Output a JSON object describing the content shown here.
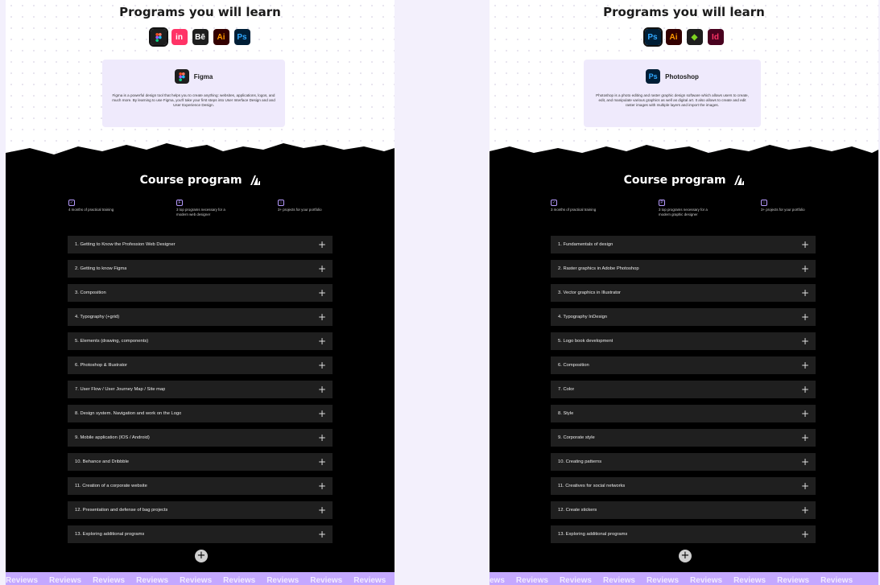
{
  "left": {
    "title": "Programs you will learn",
    "apps": [
      {
        "icon": "figma-icon",
        "text": "",
        "bg": "#1e1e1e",
        "fg": "#ffffff",
        "selected": true
      },
      {
        "icon": "invision-icon",
        "text": "in",
        "bg": "#ff3366",
        "fg": "#ffffff"
      },
      {
        "icon": "behance-icon",
        "text": "Bē",
        "bg": "#1e1e1e",
        "fg": "#ffffff"
      },
      {
        "icon": "illustrator-icon",
        "text": "Ai",
        "bg": "#330000",
        "fg": "#ff9a00"
      },
      {
        "icon": "photoshop-icon",
        "text": "Ps",
        "bg": "#001e36",
        "fg": "#31a8ff"
      }
    ],
    "card": {
      "name": "Figma",
      "description": "Figma is a powerful design tool that helps you to create anything: websites, applications, logos, and much more. By learning to use Figma, you'll take your first steps into User Interface Design and and User Experience Design."
    },
    "course_title": "Course program",
    "features": [
      "4 months of practical training",
      "3 top programs necessary for a modern web designer",
      "3+ projects for your portfolio"
    ],
    "modules": [
      "1. Getting to Know the Profession Web Designer",
      "2. Getting to know Figma",
      "3. Composition",
      "4. Typography (+grid)",
      "5. Elements (drawing, components)",
      "6. Photoshop & Illustrator",
      "7. User Flow / User Journey Map / Site map",
      "8. Design system. Navigation and work on the Logo",
      "9. Mobile application (IOS / Android)",
      "10. Behance and Dribbble",
      "11. Creation of a corporate website",
      "12. Presentation and defense of bag projects",
      "13. Exploring additional programs"
    ],
    "reviews": [
      "Reviews",
      "Reviews",
      "Reviews",
      "Reviews",
      "Reviews",
      "Reviews",
      "Reviews",
      "Reviews",
      "Reviews"
    ]
  },
  "right": {
    "title": "Programs you will learn",
    "apps": [
      {
        "icon": "photoshop-icon",
        "text": "Ps",
        "bg": "#001e36",
        "fg": "#31a8ff",
        "selected": true
      },
      {
        "icon": "illustrator-icon",
        "text": "Ai",
        "bg": "#330000",
        "fg": "#ff9a00"
      },
      {
        "icon": "coreldraw-icon",
        "text": "◆",
        "bg": "#1e1e1e",
        "fg": "#7ed321"
      },
      {
        "icon": "indesign-icon",
        "text": "Id",
        "bg": "#49021f",
        "fg": "#ff3366"
      }
    ],
    "card": {
      "name": "Photoshop",
      "description": "Photoshop is a photo editing and raster graphic design software which allows users to create, edit, and manipulate various graphics as well as digital art. It also allows to create and edit raster images with multiple layers and import the images."
    },
    "course_title": "Course program",
    "features": [
      "3 months of practical training",
      "3 top programs necessary for a modern graphic designer",
      "3+ projects for your portfolio"
    ],
    "modules": [
      "1. Fundamentals of design",
      "2. Raster graphics in Adobe Photoshop",
      "3. Vector graphics in Illustrator",
      "4. Typography InDesign",
      "5. Logo book development",
      "6. Composition",
      "7. Color",
      "8. Style",
      "9. Corporate style",
      "10. Creating patterns",
      "11. Creatives for social networks",
      "12. Create stickers",
      "13. Exploring additional programs"
    ],
    "reviews": [
      "ews",
      "Reviews",
      "Reviews",
      "Reviews",
      "Reviews",
      "Reviews",
      "Reviews",
      "Reviews",
      "Reviews"
    ]
  }
}
